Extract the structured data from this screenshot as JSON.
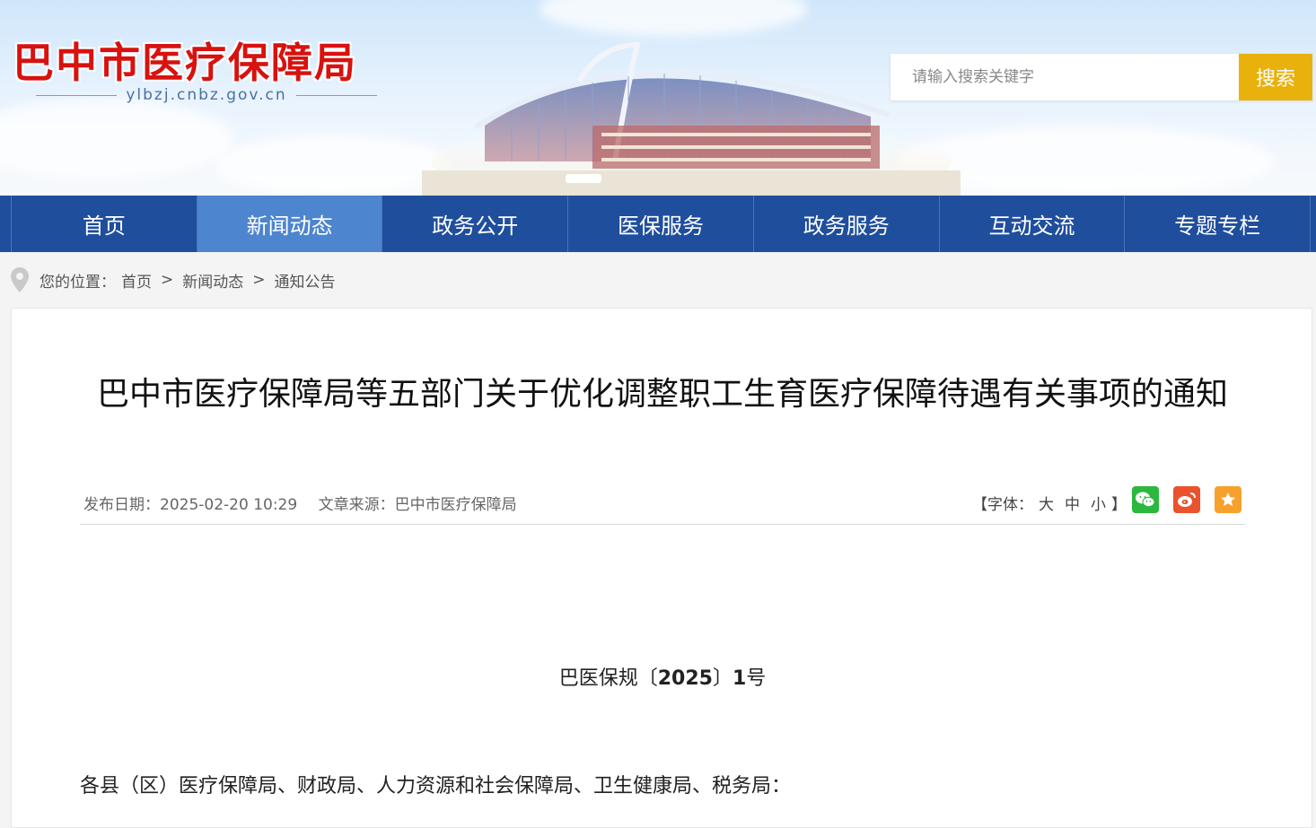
{
  "header": {
    "site_title": "巴中市医疗保障局",
    "site_domain": "ylbzj.cnbz.gov.cn",
    "search": {
      "placeholder": "请输入搜索关键字",
      "button_label": "搜索"
    }
  },
  "nav": {
    "items": [
      {
        "label": "首页",
        "active": false
      },
      {
        "label": "新闻动态",
        "active": true
      },
      {
        "label": "政务公开",
        "active": false
      },
      {
        "label": "医保服务",
        "active": false
      },
      {
        "label": "政务服务",
        "active": false
      },
      {
        "label": "互动交流",
        "active": false
      },
      {
        "label": "专题专栏",
        "active": false
      }
    ]
  },
  "breadcrumb": {
    "prefix": "您的位置：",
    "items": [
      "首页",
      "新闻动态",
      "通知公告"
    ],
    "separator": ">"
  },
  "article": {
    "title": "巴中市医疗保障局等五部门关于优化调整职工生育医疗保障待遇有关事项的通知",
    "publish_label": "发布日期：",
    "publish_date": "2025-02-20 10:29",
    "source_label": "文章来源：",
    "source": "巴中市医疗保障局",
    "font_control": {
      "open": "【字体：",
      "large": "大",
      "medium": "中",
      "small": "小",
      "close": "】"
    },
    "doc_number_prefix": "巴医保规〔",
    "doc_number_year": "2025",
    "doc_number_mid": "〕",
    "doc_number_num": "1",
    "doc_number_suffix": "号",
    "addressee": "各县（区）医疗保障局、财政局、人力资源和社会保障局、卫生健康局、税务局："
  },
  "share": {
    "wechat_color": "#2cb73f",
    "weibo_color": "#e9522c",
    "favorite_color": "#f6a12b"
  },
  "colors": {
    "nav_bg": "#1f4e9c",
    "nav_active": "#4d85cf",
    "title_red": "#d7120f",
    "search_btn": "#e8b10c"
  }
}
